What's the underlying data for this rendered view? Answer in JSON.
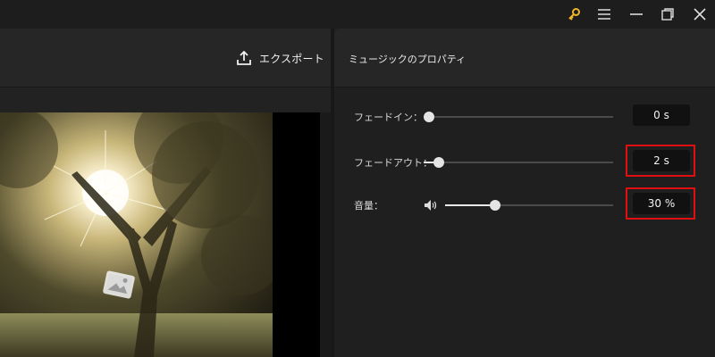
{
  "window": {
    "key_icon_color": "#f0b429"
  },
  "toolbar": {
    "export_label": "エクスポート"
  },
  "properties_panel": {
    "title": "ミュージックのプロパティ",
    "fade_in": {
      "label": "フェードイン：",
      "value": "0 s",
      "level": 0
    },
    "fade_out": {
      "label": "フェードアウト：",
      "value": "2 s",
      "level": 0.08,
      "highlight_color": "#e01010"
    },
    "volume": {
      "label": "音量：",
      "value": "30 %",
      "level": 0.3,
      "highlight_color": "#e01010"
    }
  }
}
